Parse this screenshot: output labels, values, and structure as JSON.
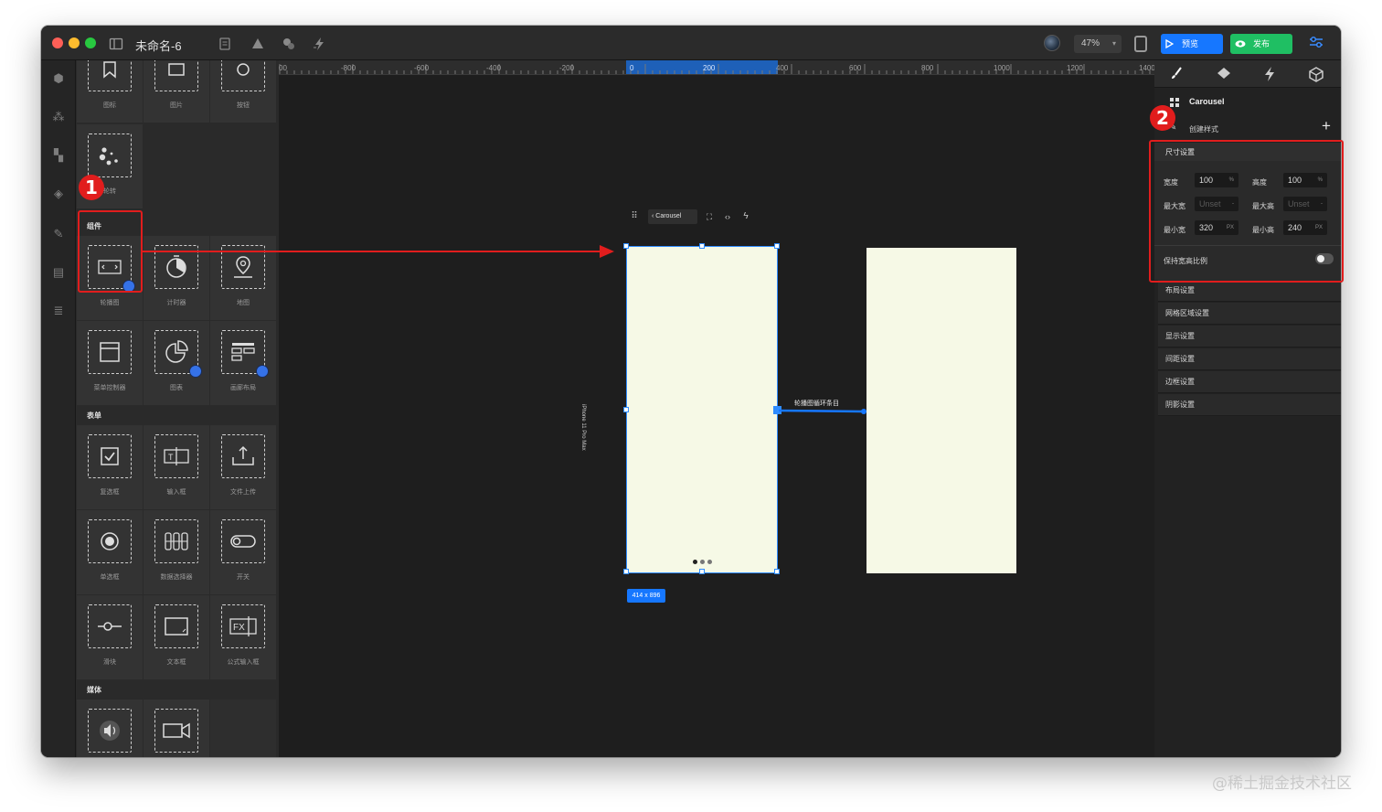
{
  "window": {
    "title": "未命名-6",
    "zoom": "47%",
    "preview_label": "预览",
    "publish_label": "发布"
  },
  "palette": {
    "top_row": [
      "图标",
      "图片",
      "按钮"
    ],
    "sections": [
      {
        "title": "组件",
        "items": [
          "轮播图",
          "计时器",
          "地图",
          "菜单控制器",
          "图表",
          "画廊布局"
        ]
      },
      {
        "title": "表单",
        "items": [
          "复选框",
          "输入框",
          "文件上传",
          "单选框",
          "数据选择器",
          "开关",
          "滑块",
          "文本框",
          "公式输入框"
        ]
      },
      {
        "title": "媒体",
        "items": [
          "音频",
          "视频"
        ]
      }
    ],
    "misc_items": [
      "轮转"
    ]
  },
  "ruler": {
    "ticks": [
      "00",
      "-800",
      "-600",
      "-400",
      "-200",
      "0",
      "200",
      "400",
      "600",
      "800",
      "1000",
      "1200",
      "1400"
    ]
  },
  "canvas": {
    "float_toolbar_label": "Carousel",
    "connection_label": "轮播图循环条目",
    "artboard_size": "414 x 896",
    "artboard_side_text": "iPhone 11 Pro Max"
  },
  "inspector": {
    "component_name": "Carousel",
    "create_style_label": "创建样式",
    "size_section_title": "尺寸设置",
    "width_label": "宽度",
    "width_value": "100",
    "width_unit": "%",
    "height_label": "高度",
    "height_value": "100",
    "height_unit": "%",
    "max_width_label": "最大宽",
    "max_width_value": "Unset",
    "max_width_unit": "-",
    "max_height_label": "最大高",
    "max_height_value": "Unset",
    "max_height_unit": "-",
    "min_width_label": "最小宽",
    "min_width_value": "320",
    "min_width_unit": "PX",
    "min_height_label": "最小高",
    "min_height_value": "240",
    "min_height_unit": "PX",
    "keep_ratio_label": "保持宽高比例",
    "keep_ratio_on": false,
    "sections": [
      "布局设置",
      "网格区域设置",
      "显示设置",
      "间距设置",
      "边框设置",
      "阴影设置"
    ]
  },
  "annotations": {
    "badge_1": "1",
    "badge_2": "2"
  },
  "watermark": "@稀土掘金技术社区",
  "colors": {
    "accent": "#1677ff",
    "publish": "#1fbf63",
    "annotation": "#e11d1d",
    "artboard": "#f6f9e6"
  }
}
